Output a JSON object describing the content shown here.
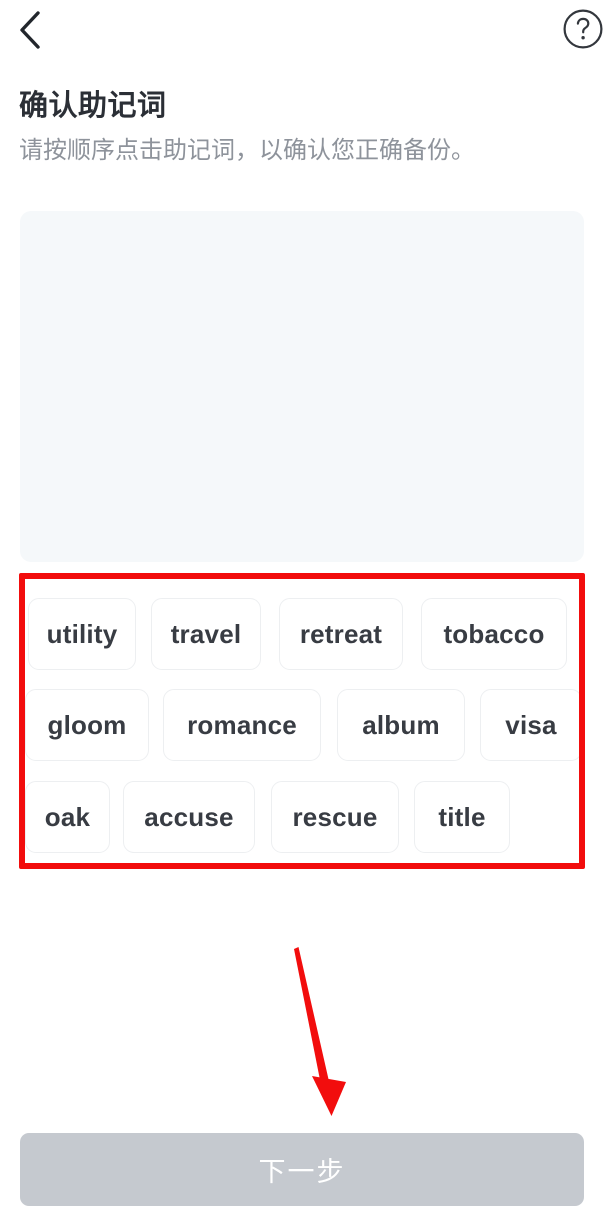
{
  "header": {
    "back_icon": "chevron-left-icon",
    "help_icon": "help-circle-icon",
    "back_label": "",
    "help_label": "?"
  },
  "page": {
    "title": "确认助记词",
    "subtitle": "请按顺序点击助记词，以确认您正确备份。"
  },
  "answer_panel": {
    "selected_words": [],
    "background_color": "#f5f8fa"
  },
  "word_bank": {
    "rows": [
      {
        "words": [
          "utility",
          "travel",
          "retreat",
          "tobacco"
        ]
      },
      {
        "words": [
          "gloom",
          "romance",
          "album",
          "visa"
        ]
      },
      {
        "words": [
          "oak",
          "accuse",
          "rescue",
          "title"
        ]
      }
    ],
    "all_words": [
      "utility",
      "travel",
      "retreat",
      "tobacco",
      "gloom",
      "romance",
      "album",
      "visa",
      "oak",
      "accuse",
      "rescue",
      "title"
    ]
  },
  "annotations": {
    "box_color": "#f20d0d",
    "arrow_color": "#f20d0d",
    "box_target": "word-bank",
    "arrow_target": "next-button"
  },
  "footer": {
    "next_label": "下一步",
    "next_enabled": false,
    "next_bg_color": "#c5c9cf"
  }
}
